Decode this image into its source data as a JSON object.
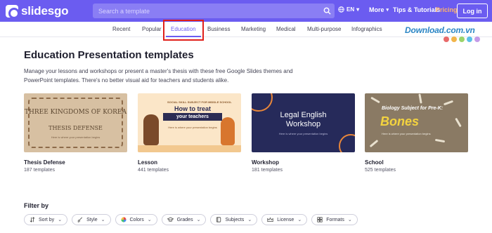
{
  "header": {
    "logo_text": "slidesgo",
    "search_placeholder": "Search a template",
    "language": "EN",
    "more_label": "More",
    "tips_label": "Tips & Tutorials",
    "pricing_label": "Pricing",
    "login_label": "Log in"
  },
  "colors": {
    "brand": "#6b5cf0",
    "pricing": "#ffb26b",
    "highlight": "#e0201b"
  },
  "categories": [
    "Recent",
    "Popular",
    "Education",
    "Business",
    "Marketing",
    "Medical",
    "Multi-purpose",
    "Infographics"
  ],
  "active_category": "Education",
  "watermark": {
    "text": "Download.com.vn"
  },
  "page": {
    "title": "Education Presentation templates",
    "description": "Manage your lessons and workshops or present a master's thesis with these free Google Slides themes and PowerPoint templates. There's no better visual aid for teachers and students alike."
  },
  "cards": [
    {
      "title": "Thesis Defense",
      "count": "187 templates",
      "thumb_lines": [
        "THREE KINGDOMS OF KOREA",
        "THESIS DEFENSE",
        "Here is where your presentation begins"
      ]
    },
    {
      "title": "Lesson",
      "count": "441 templates",
      "thumb_lines": [
        "SOCIAL SKILL SUBJECT FOR MIDDLE SCHOOL",
        "How to treat",
        "your teachers",
        "Here is where your presentation begins"
      ]
    },
    {
      "title": "Workshop",
      "count": "181 templates",
      "thumb_lines": [
        "Legal English",
        "Workshop",
        "Here is where your presentation begins"
      ]
    },
    {
      "title": "School",
      "count": "525 templates",
      "thumb_lines": [
        "Biology Subject for Pre-K:",
        "Bones",
        "Here is where your presentation begins"
      ]
    }
  ],
  "filters": {
    "title": "Filter by",
    "chips": [
      {
        "label": "Sort by",
        "icon": "sort-icon"
      },
      {
        "label": "Style",
        "icon": "brush-icon"
      },
      {
        "label": "Colors",
        "icon": "color-wheel-icon"
      },
      {
        "label": "Grades",
        "icon": "graduation-cap-icon"
      },
      {
        "label": "Subjects",
        "icon": "book-icon"
      },
      {
        "label": "License",
        "icon": "crown-icon"
      },
      {
        "label": "Formats",
        "icon": "grid-icon"
      }
    ]
  }
}
